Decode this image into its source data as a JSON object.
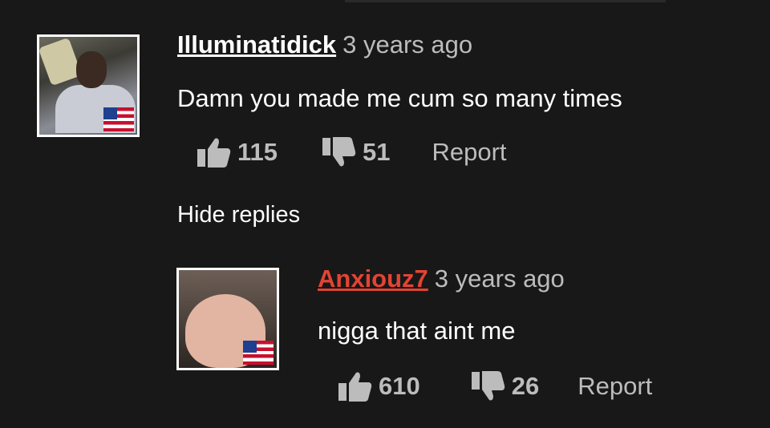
{
  "comments": [
    {
      "username": "Illuminatidick",
      "time": "3 years ago",
      "text": "Damn you made me cum so many times",
      "likes": "115",
      "dislikes": "51",
      "report": "Report",
      "flag_icon": "us-flag-icon"
    },
    {
      "username": "Anxiouz7",
      "time": "3 years ago",
      "text": "nigga that aint me",
      "likes": "610",
      "dislikes": "26",
      "report": "Report",
      "flag_icon": "us-flag-icon"
    }
  ],
  "hide_replies": "Hide replies",
  "colors": {
    "background": "#181818",
    "reply_username": "#e24433",
    "muted": "#bcbcbc"
  }
}
